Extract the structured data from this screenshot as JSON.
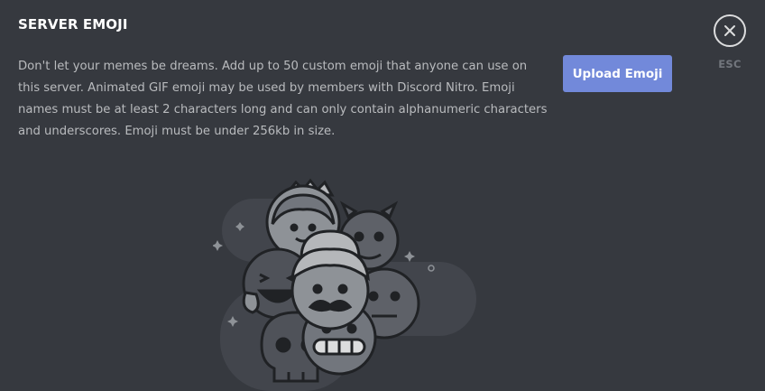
{
  "header": {
    "title": "SERVER EMOJI"
  },
  "description": "Don't let your memes be dreams. Add up to 50 custom emoji that anyone can use on this server. Animated GIF emoji may be used by members with Discord Nitro. Emoji names must be at least 2 characters long and can only contain alphanumeric characters and underscores. Emoji must be under 256kb in size.",
  "actions": {
    "upload_label": "Upload Emoji"
  },
  "close": {
    "icon": "close-icon",
    "esc_label": "ESC"
  },
  "colors": {
    "background": "#36393f",
    "accent": "#7289da",
    "title": "#ffffff",
    "body_text": "#b9bbbe",
    "muted": "#72767d"
  }
}
